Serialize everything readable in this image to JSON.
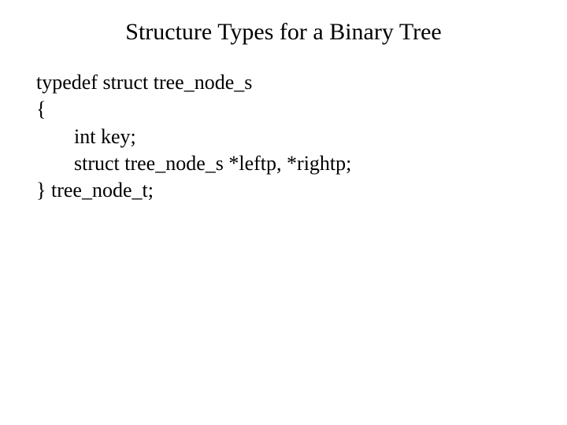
{
  "title": "Structure Types for a Binary Tree",
  "code": {
    "line1": "typedef struct tree_node_s",
    "line2": "{",
    "line3": "int key;",
    "line4": "struct tree_node_s *leftp, *rightp;",
    "line5": "} tree_node_t;"
  }
}
